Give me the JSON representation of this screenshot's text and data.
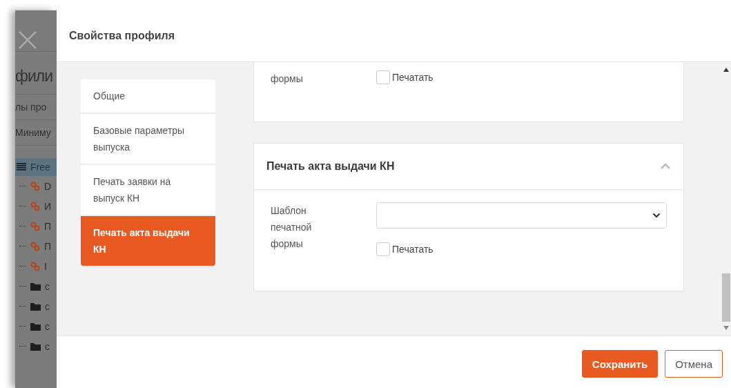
{
  "background_page": {
    "title": "фили",
    "rows": [
      "лы про",
      "Миниму"
    ],
    "tree": {
      "label": "Free",
      "selected": true,
      "children": [
        {
          "kind": "link",
          "label": "D"
        },
        {
          "kind": "link",
          "label": "И"
        },
        {
          "kind": "link",
          "label": "П"
        },
        {
          "kind": "link",
          "label": "П"
        },
        {
          "kind": "link",
          "label": "I"
        },
        {
          "kind": "folder",
          "label": "с"
        },
        {
          "kind": "folder",
          "label": "с"
        },
        {
          "kind": "folder",
          "label": "с"
        },
        {
          "kind": "folder",
          "label": "с"
        }
      ]
    }
  },
  "dialog": {
    "title": "Свойства профиля",
    "nav": [
      {
        "label": "Общие",
        "selected": false
      },
      {
        "label": "Базовые параметры выпуска",
        "selected": false
      },
      {
        "label": "Печать заявки на выпуск КН",
        "selected": false
      },
      {
        "label": "Печать акта выдачи КН",
        "selected": true
      }
    ],
    "sections": [
      {
        "fields": [
          {
            "kind": "checkbox",
            "label": "формы",
            "checkbox": {
              "label": "Печатать",
              "checked": false
            }
          }
        ]
      },
      {
        "title": "Печать акта выдачи КН",
        "expanded": true,
        "fields": [
          {
            "kind": "select",
            "label": "Шаблон печатной формы",
            "checkbox": {
              "label": "Печатать",
              "checked": false
            }
          }
        ]
      }
    ],
    "buttons": [
      {
        "label": "Сохранить",
        "kind": "primary"
      },
      {
        "label": "Отмена",
        "kind": "secondary"
      }
    ]
  }
}
